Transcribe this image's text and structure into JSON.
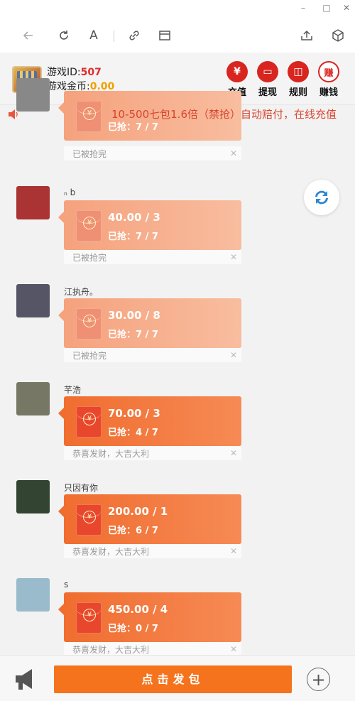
{
  "window": {
    "minimize": "–",
    "maximize": "□",
    "close": "✕"
  },
  "toolbar": {
    "font_label": "A"
  },
  "game": {
    "id_label": "游戏ID:",
    "id_value": "507",
    "coin_label": "游戏金币:",
    "coin_value": "0.00",
    "actions": [
      {
        "label": "充值",
        "glyph": "¥"
      },
      {
        "label": "提现",
        "glyph": "▭"
      },
      {
        "label": "规则",
        "glyph": "◫"
      },
      {
        "label": "赚钱",
        "glyph": "赚"
      }
    ]
  },
  "marquee": "10-500七包1.6倍（禁抢）自动赔付，在线充值",
  "messages": [
    {
      "name": "",
      "amount": "",
      "grabbed": "已抢：7 / 7",
      "footer": "已被抢完",
      "status": "claimed"
    },
    {
      "name": "ₙ b",
      "amount": "40.00 / 3",
      "grabbed": "已抢：7 / 7",
      "footer": "已被抢完",
      "status": "claimed"
    },
    {
      "name": "江执舟。",
      "amount": "30.00 / 8",
      "grabbed": "已抢：7 / 7",
      "footer": "已被抢完",
      "status": "claimed"
    },
    {
      "name": "芊浩",
      "amount": "70.00 / 3",
      "grabbed": "已抢：4 / 7",
      "footer": "恭喜发财，大吉大利",
      "status": "active"
    },
    {
      "name": "只因有你",
      "amount": "200.00 / 1",
      "grabbed": "已抢：6 / 7",
      "footer": "恭喜发财，大吉大利",
      "status": "active"
    },
    {
      "name": "ѕ",
      "amount": "450.00 / 4",
      "grabbed": "已抢：0 / 7",
      "footer": "恭喜发财，大吉大利",
      "status": "active"
    }
  ],
  "envelope_glyph": "¥",
  "send_button": "点击发包",
  "colors": {
    "accent": "#f5731c",
    "red": "#d8251f",
    "claimed": "#f5a27d",
    "active": "#f06d2f"
  }
}
